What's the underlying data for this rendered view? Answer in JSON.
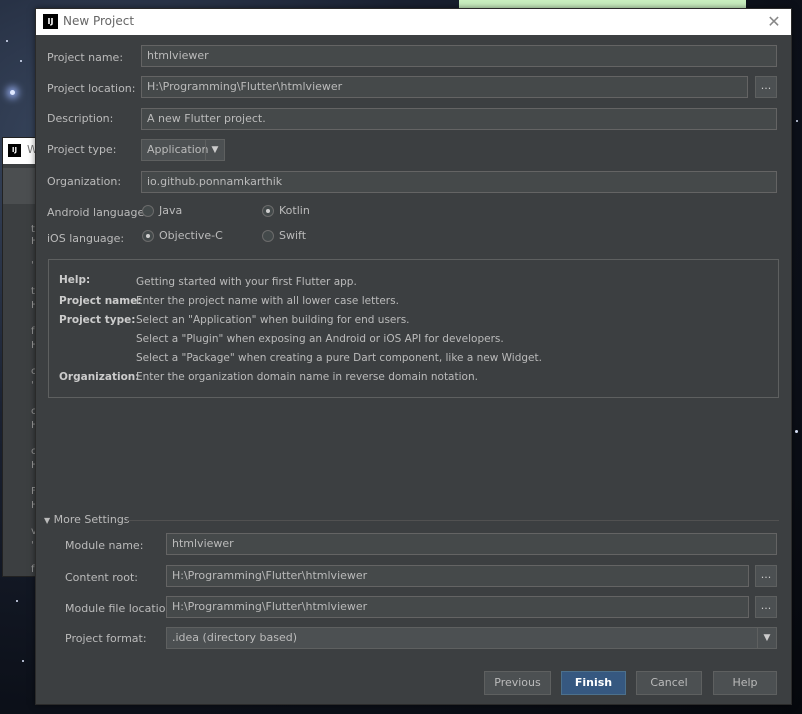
{
  "dialog": {
    "title": "New Project",
    "logo_text": "IJ",
    "close_icon": "close-icon"
  },
  "form": {
    "project_name_label": "Project name:",
    "project_name_value": "htmlviewer",
    "project_location_label": "Project location:",
    "project_location_value": "H:\\Programming\\Flutter\\htmlviewer",
    "description_label": "Description:",
    "description_value": "A new Flutter project.",
    "project_type_label": "Project type:",
    "project_type_value": "Application",
    "organization_label": "Organization:",
    "organization_value": "io.github.ponnamkarthik",
    "android_language_label": "Android language:",
    "android_options": [
      {
        "label": "Java",
        "selected": false
      },
      {
        "label": "Kotlin",
        "selected": true
      }
    ],
    "ios_language_label": "iOS language:",
    "ios_options": [
      {
        "label": "Objective-C",
        "selected": true
      },
      {
        "label": "Swift",
        "selected": false
      }
    ],
    "browse_label": "..."
  },
  "help": {
    "help_label": "Help:",
    "help_link": "Getting started with your first Flutter app.",
    "project_name_label": "Project name:",
    "project_name_text": "Enter the project name with all lower case letters.",
    "project_type_label": "Project type:",
    "project_type_lines": [
      "Select an \"Application\" when building for end users.",
      "Select a \"Plugin\" when exposing an Android or iOS API for developers.",
      "Select a \"Package\" when creating a pure Dart component, like a new Widget."
    ],
    "organization_label": "Organization:",
    "organization_text": "Enter the organization domain name in reverse domain notation."
  },
  "more_settings": {
    "title": "More Settings",
    "expanded": true,
    "module_name_label": "Module name:",
    "module_name_value": "htmlviewer",
    "content_root_label": "Content root:",
    "content_root_value": "H:\\Programming\\Flutter\\htmlviewer",
    "module_file_label": "Module file location:",
    "module_file_value": "H:\\Programming\\Flutter\\htmlviewer",
    "project_format_label": "Project format:",
    "project_format_value": ".idea (directory based)"
  },
  "buttons": {
    "previous": "Previous",
    "finish": "Finish",
    "cancel": "Cancel",
    "help": "Help"
  },
  "background_window": {
    "title_fragment": "W",
    "logo_text": "IJ",
    "fragments": [
      "t",
      "H",
      "'",
      "t",
      "H",
      "f",
      "H",
      "c",
      "'",
      "c",
      "H",
      "c",
      "H",
      "F",
      "H",
      "v",
      "'",
      "f"
    ]
  },
  "colors": {
    "dialog_bg": "#3c3f41",
    "field_bg": "#45494a",
    "link": "#589df6",
    "primary_button": "#365880"
  }
}
